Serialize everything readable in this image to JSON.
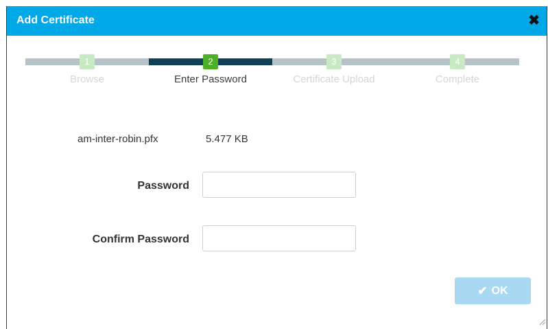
{
  "dialog": {
    "title": "Add Certificate",
    "close_glyph": "✖",
    "accent_color": "#00a8e8"
  },
  "wizard": {
    "steps": [
      {
        "number": "1",
        "label": "Browse",
        "state": "inactive"
      },
      {
        "number": "2",
        "label": "Enter Password",
        "state": "active"
      },
      {
        "number": "3",
        "label": "Certificate Upload",
        "state": "inactive"
      },
      {
        "number": "4",
        "label": "Complete",
        "state": "inactive"
      }
    ],
    "current_step": 2
  },
  "file": {
    "name": "am-inter-robin.pfx",
    "size": "5.477 KB"
  },
  "form": {
    "password_label": "Password",
    "password_value": "",
    "confirm_label": "Confirm Password",
    "confirm_value": ""
  },
  "footer": {
    "ok_label": "OK",
    "ok_icon": "check-icon",
    "ok_enabled": false
  }
}
